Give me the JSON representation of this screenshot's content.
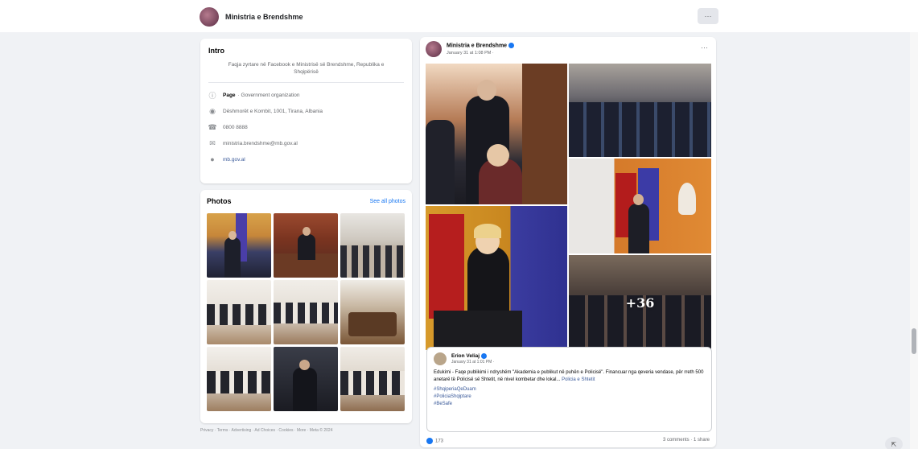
{
  "topbar": {
    "page_name": "Ministria e Brendshme",
    "more_label": "···"
  },
  "intro": {
    "title": "Intro",
    "description": "Faqja zyrtare në Facebook e Ministrisë së Brendshme, Republika e Shqipërisë",
    "rows": [
      {
        "icon": "info-icon",
        "bold": "Page",
        "text": "· Government organization"
      },
      {
        "icon": "location-icon",
        "bold": "",
        "text": "Dëshmorët e Kombit, 1001, Tirana, Albania"
      },
      {
        "icon": "phone-icon",
        "bold": "",
        "text": "0800 8888"
      },
      {
        "icon": "mail-icon",
        "bold": "",
        "text": "ministria.brendshme@mb.gov.al"
      },
      {
        "icon": "globe-icon",
        "bold": "",
        "text": "mb.gov.al"
      }
    ]
  },
  "photos": {
    "title": "Photos",
    "see_all": "See all photos"
  },
  "footer": "Privacy · Terms · Advertising · Ad Choices · Cookies · More · Meta © 2024",
  "post": {
    "author": "Ministria e Brendshme",
    "time": "January 31 at 1:08 PM ·",
    "more_count": "+36",
    "shared": {
      "author": "Erion Veliaj",
      "time": "January 31 at 1:01 PM ·",
      "text": "Edukimi - Faqe publikimi i ndryshëm \"Akademia e publikut në puhën e Policisë\". Financuar nga qeveria vendase, për rreth 500 anetarë të Policisë së Shtetit, në nivel kombetar dhe lokal...",
      "link": "Policia e Shtetit",
      "hashtags": [
        "#ShqiperiaQeDuam",
        "#PoliciaShqiptare",
        "#BeSafe"
      ]
    },
    "likes": "173",
    "stats": "3 comments · 1 share"
  },
  "colors": {
    "link": "#385898",
    "accent": "#1877f2",
    "feed_bg": "#f0f2f5"
  }
}
